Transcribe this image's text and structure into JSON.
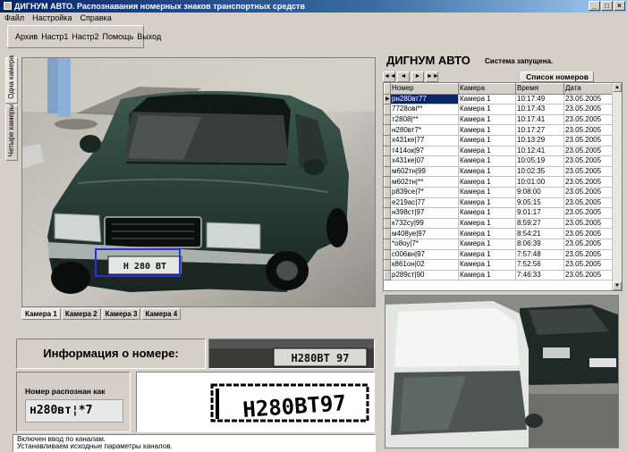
{
  "window": {
    "title": "ДИГНУМ АВТО. Распознавания номерных знаков транспортных средств"
  },
  "menu": [
    "Файл",
    "Настройка",
    "Справка"
  ],
  "toolbar": [
    "Архив",
    "Настр1",
    "Настр2",
    "Помощь",
    "Выход"
  ],
  "side_tabs": [
    "Одна камера",
    "Четыре камеры"
  ],
  "camera_tabs": [
    "Камера 1",
    "Камера 2",
    "Камера 3",
    "Камера 4"
  ],
  "camera_plate_text": "Н 280 ВТ",
  "info": {
    "title": "Информация о номере:",
    "plate_photo_text": "Н280ВТ 97",
    "recognized_label": "Номер распознан как",
    "recognized_value": "н280вт¦*7",
    "binary_plate_text": "Н280ВТ97"
  },
  "log": [
    "Включен ввод по каналам.",
    "Устанавливаем исходные параметры каналов."
  ],
  "right": {
    "title": "ДИГНУМ АВТО",
    "status": "Система запущена.",
    "list_tab": "Список номеров",
    "nav": [
      "◄◄",
      "◄",
      "►",
      "►►"
    ]
  },
  "table": {
    "columns": [
      "Номер",
      "Камера",
      "Время",
      "Дата"
    ],
    "rows": [
      [
        "рн280вт77",
        "Камера 1",
        "10:17:49",
        "23.05.2005"
      ],
      [
        "7728ові**",
        "Камера 1",
        "10:17:43",
        "23.05.2005"
      ],
      [
        "т2808|**",
        "Камера 1",
        "10:17:41",
        "23.05.2005"
      ],
      [
        "н280вт7*",
        "Камера 1",
        "10:17:27",
        "23.05.2005"
      ],
      [
        "х431ке|77",
        "Камера 1",
        "10:13:29",
        "23.05.2005"
      ],
      [
        "т414ок|97",
        "Камера 1",
        "10:12:41",
        "23.05.2005"
      ],
      [
        "х431ке|07",
        "Камера 1",
        "10:05:19",
        "23.05.2005"
      ],
      [
        "м602тн|99",
        "Камера 1",
        "10:02:35",
        "23.05.2005"
      ],
      [
        "м602тн|**",
        "Камера 1",
        "10:01:00",
        "23.05.2005"
      ],
      [
        "р839се|7*",
        "Камера 1",
        "9:08:00",
        "23.05.2005"
      ],
      [
        "е219ас|77",
        "Камера 1",
        "9:05:15",
        "23.05.2005"
      ],
      [
        "н398ст|97",
        "Камера 1",
        "9:01:17",
        "23.05.2005"
      ],
      [
        "к732су|99",
        "Камера 1",
        "8:59:27",
        "23.05.2005"
      ],
      [
        "м408уе|97",
        "Камера 1",
        "8:54:21",
        "23.05.2005"
      ],
      [
        "*о8оу|7*",
        "Камера 1",
        "8:06:39",
        "23.05.2005"
      ],
      [
        "с006вн|97",
        "Камера 1",
        "7:57:48",
        "23.05.2005"
      ],
      [
        "к861он|02",
        "Камера 1",
        "7:52:56",
        "23.05.2005"
      ],
      [
        "р289ст|90",
        "Камера 1",
        "7:46:33",
        "23.05.2005"
      ]
    ]
  },
  "colors": {
    "titlebar": "#0a246a",
    "selection": "#0a246a",
    "face": "#d4d0c8",
    "camera_highlight": "#2233dd"
  },
  "icons": {
    "row_indicator": "row-pointer-icon",
    "scroll_up": "scroll-up-icon",
    "scroll_down": "scroll-down-icon"
  }
}
